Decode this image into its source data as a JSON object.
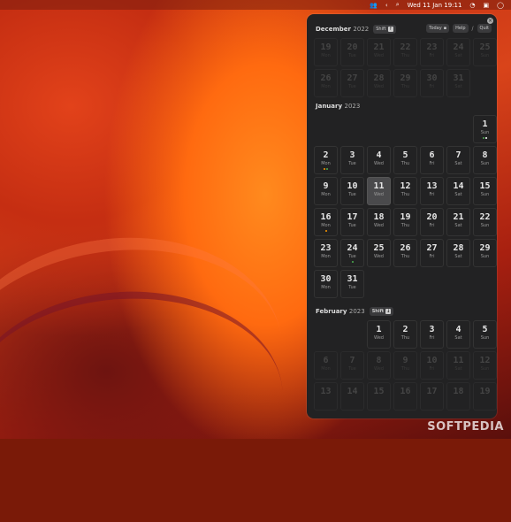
{
  "menubar": {
    "date_time": "Wed 11 Jan  19:11"
  },
  "panel": {
    "top_month": {
      "name": "December",
      "year": "2022",
      "shift_label": "Shift",
      "shift_arrow": "↑"
    },
    "today_label": "Today",
    "help_label": "Help",
    "help_sep": "/",
    "quit_label": "Quit",
    "close_glyph": "×",
    "months": [
      {
        "name": "January",
        "year": "2023"
      },
      {
        "name": "February",
        "year": "2023",
        "shift_label": "Shift",
        "shift_arrow": "↓"
      }
    ]
  },
  "days": [
    {
      "n": "19",
      "w": "Mon",
      "dim": true
    },
    {
      "n": "20",
      "w": "Tue",
      "dim": true
    },
    {
      "n": "21",
      "w": "Wed",
      "dim": true
    },
    {
      "n": "22",
      "w": "Thu",
      "dim": true
    },
    {
      "n": "23",
      "w": "Fri",
      "dim": true
    },
    {
      "n": "24",
      "w": "Sat",
      "dim": true
    },
    {
      "n": "25",
      "w": "Sun",
      "dim": true
    },
    {
      "n": "26",
      "w": "Mon",
      "dim": true
    },
    {
      "n": "27",
      "w": "Tue",
      "dim": true
    },
    {
      "n": "28",
      "w": "Wed",
      "dim": true
    },
    {
      "n": "29",
      "w": "Thu",
      "dim": true
    },
    {
      "n": "30",
      "w": "Fri",
      "dim": true
    },
    {
      "n": "31",
      "w": "Sat",
      "dim": true
    },
    {
      "n": "1",
      "w": "Sun",
      "dots": [
        "#4caf50",
        "#ffffff"
      ]
    },
    {
      "n": "2",
      "w": "Mon",
      "dots": [
        "#ff9800",
        "#4caf50"
      ]
    },
    {
      "n": "3",
      "w": "Tue"
    },
    {
      "n": "4",
      "w": "Wed"
    },
    {
      "n": "5",
      "w": "Thu"
    },
    {
      "n": "6",
      "w": "Fri"
    },
    {
      "n": "7",
      "w": "Sat"
    },
    {
      "n": "8",
      "w": "Sun"
    },
    {
      "n": "9",
      "w": "Mon"
    },
    {
      "n": "10",
      "w": "Tue"
    },
    {
      "n": "11",
      "w": "Wed",
      "today": true
    },
    {
      "n": "12",
      "w": "Thu"
    },
    {
      "n": "13",
      "w": "Fri"
    },
    {
      "n": "14",
      "w": "Sat"
    },
    {
      "n": "15",
      "w": "Sun"
    },
    {
      "n": "16",
      "w": "Mon",
      "dots": [
        "#ff9800"
      ]
    },
    {
      "n": "17",
      "w": "Tue"
    },
    {
      "n": "18",
      "w": "Wed"
    },
    {
      "n": "19",
      "w": "Thu"
    },
    {
      "n": "20",
      "w": "Fri"
    },
    {
      "n": "21",
      "w": "Sat"
    },
    {
      "n": "22",
      "w": "Sun"
    },
    {
      "n": "23",
      "w": "Mon"
    },
    {
      "n": "24",
      "w": "Tue",
      "dots": [
        "#4caf50"
      ]
    },
    {
      "n": "25",
      "w": "Wed"
    },
    {
      "n": "26",
      "w": "Thu"
    },
    {
      "n": "27",
      "w": "Fri"
    },
    {
      "n": "28",
      "w": "Sat"
    },
    {
      "n": "29",
      "w": "Sun"
    },
    {
      "n": "30",
      "w": "Mon"
    },
    {
      "n": "31",
      "w": "Tue"
    },
    {
      "n": "1",
      "w": "Wed"
    },
    {
      "n": "2",
      "w": "Thu"
    },
    {
      "n": "3",
      "w": "Fri"
    },
    {
      "n": "4",
      "w": "Sat"
    },
    {
      "n": "5",
      "w": "Sun"
    },
    {
      "n": "6",
      "w": "Mon",
      "dim": true
    },
    {
      "n": "7",
      "w": "Tue",
      "dim": true
    },
    {
      "n": "8",
      "w": "Wed",
      "dim": true
    },
    {
      "n": "9",
      "w": "Thu",
      "dim": true
    },
    {
      "n": "10",
      "w": "Fri",
      "dim": true
    },
    {
      "n": "11",
      "w": "Sat",
      "dim": true
    },
    {
      "n": "12",
      "w": "Sun",
      "dim": true
    },
    {
      "n": "13",
      "w": "",
      "dim": true
    },
    {
      "n": "14",
      "w": "",
      "dim": true
    },
    {
      "n": "15",
      "w": "",
      "dim": true
    },
    {
      "n": "16",
      "w": "",
      "dim": true
    },
    {
      "n": "17",
      "w": "",
      "dim": true
    },
    {
      "n": "18",
      "w": "",
      "dim": true
    },
    {
      "n": "19",
      "w": "",
      "dim": true
    }
  ],
  "watermark": "SOFTPEDIA"
}
